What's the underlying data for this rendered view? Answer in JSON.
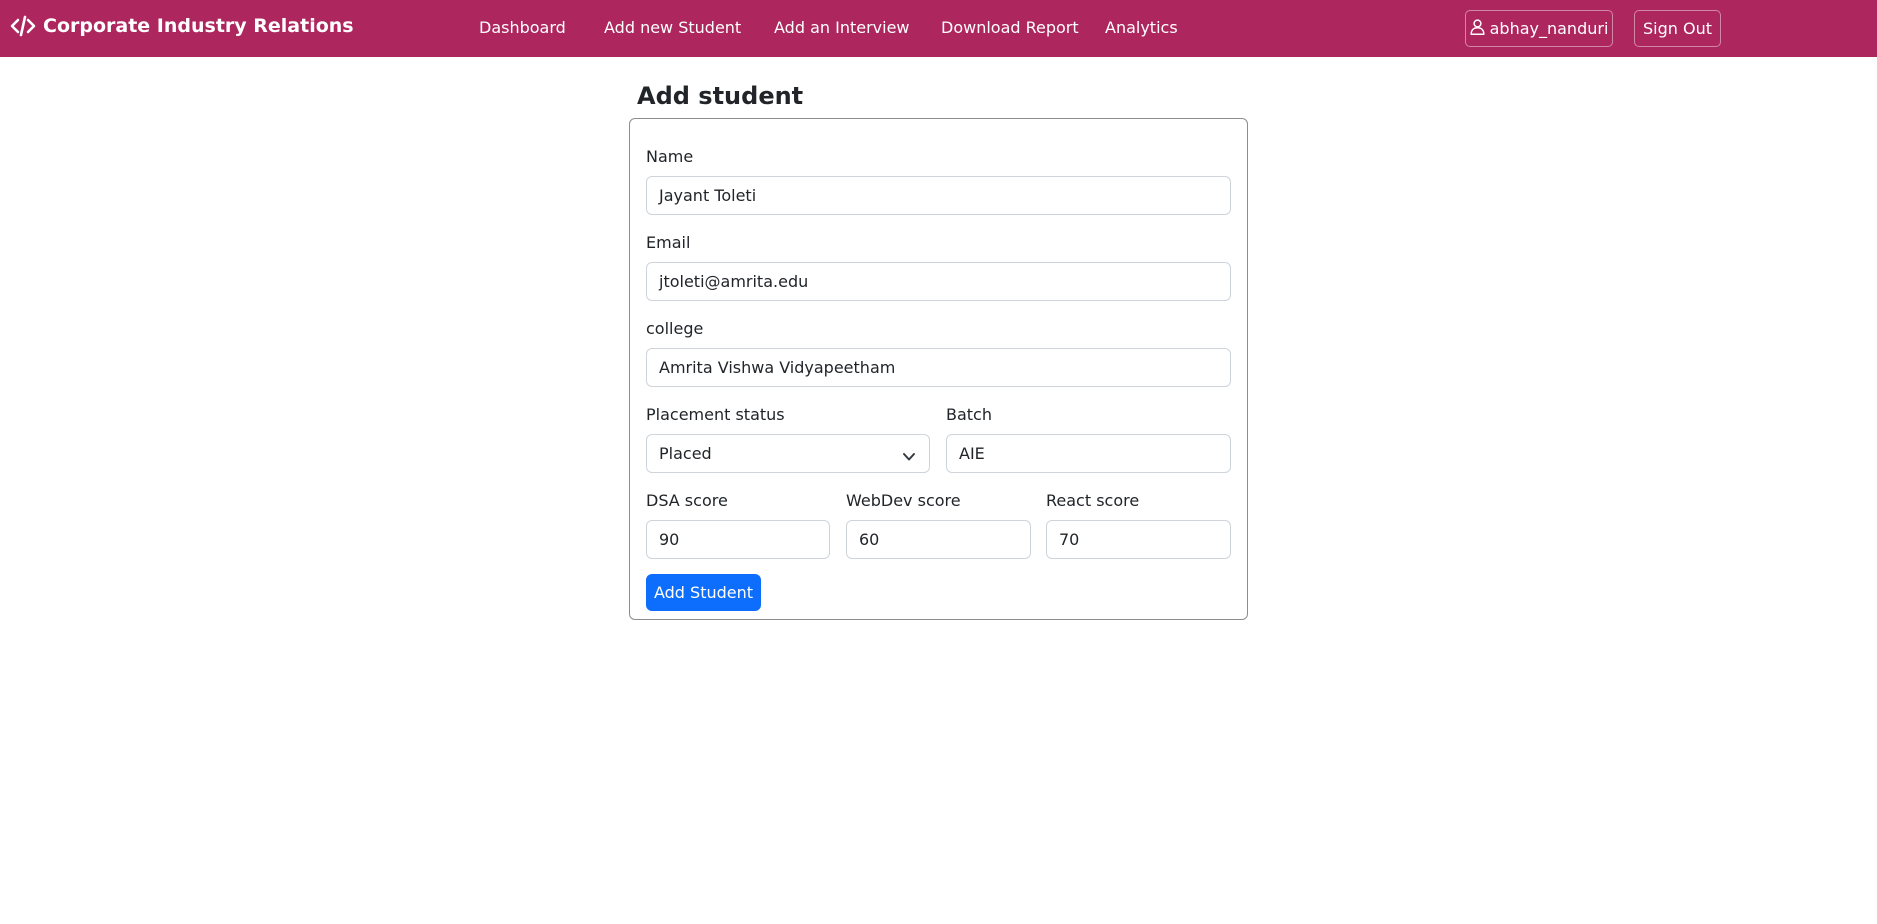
{
  "navbar": {
    "brand": "Corporate Industry Relations",
    "brand_icon": "code-icon",
    "links": [
      "Dashboard",
      "Add new Student",
      "Add an Interview",
      "Download Report",
      "Analytics"
    ],
    "user_button": "abhay_nanduri",
    "user_icon": "person-icon",
    "signout_button": "Sign Out",
    "color": "#ad265e"
  },
  "page": {
    "title": "Add student"
  },
  "form": {
    "name": {
      "label": "Name",
      "value": "Jayant Toleti"
    },
    "email": {
      "label": "Email",
      "value": "jtoleti@amrita.edu"
    },
    "college": {
      "label": "college",
      "value": "Amrita Vishwa Vidyapeetham"
    },
    "placement_status": {
      "label": "Placement status",
      "value": "Placed"
    },
    "batch": {
      "label": "Batch",
      "value": "AIE"
    },
    "dsa_score": {
      "label": "DSA score",
      "value": "90"
    },
    "webdev_score": {
      "label": "WebDev score",
      "value": "60"
    },
    "react_score": {
      "label": "React score",
      "value": "70"
    },
    "submit_label": "Add Student",
    "submit_color": "#0d6efd"
  }
}
